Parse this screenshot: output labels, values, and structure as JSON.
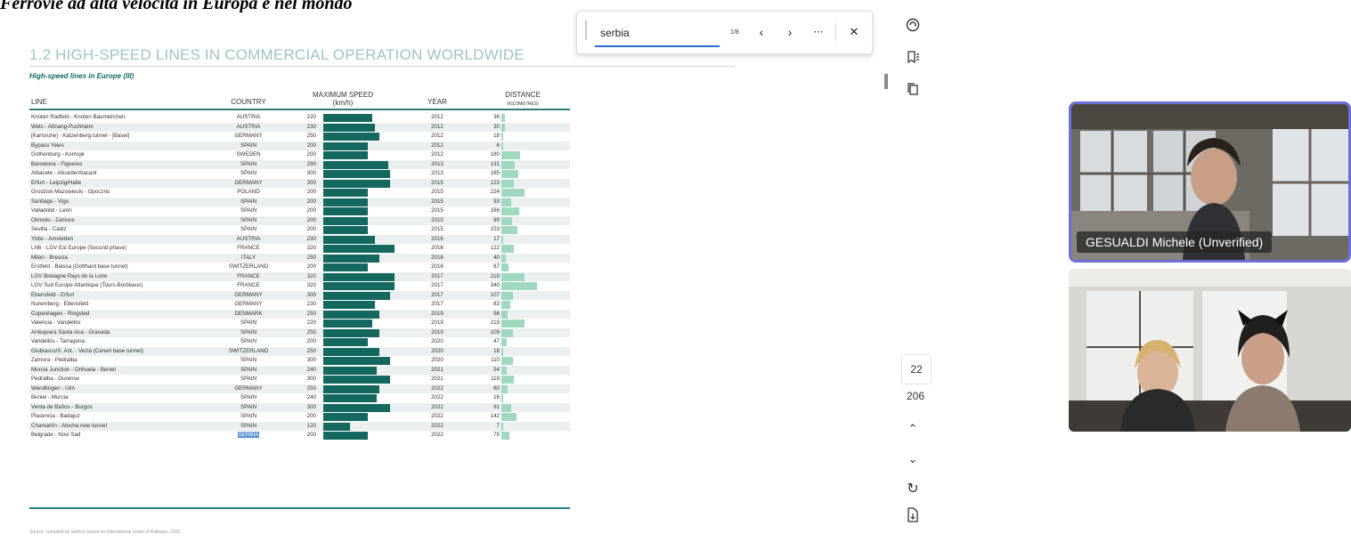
{
  "banner": {
    "text": "Ferrovie ad alta velocità in Europa e nel mondo"
  },
  "document": {
    "title": "1.2 HIGH-SPEED LINES IN COMMERCIAL OPERATION WORLDWIDE",
    "subtitle": "High-speed lines in Europe (III)",
    "columns": {
      "line": "LINE",
      "country": "COUNTRY",
      "speed": "MAXIMUM SPEED",
      "speed_unit": "(km/h)",
      "year": "YEAR",
      "distance": "DISTANCE",
      "distance_unit": "(KILOMETRES)"
    },
    "rows": [
      {
        "line": "Knoten Radfeld - Knoten Baumkirchen",
        "country": "AUSTRIA",
        "speed": 220,
        "year": "2012",
        "distance": 36
      },
      {
        "line": "Wels - Attnang-Puchheim",
        "country": "AUSTRIA",
        "speed": 230,
        "year": "2012",
        "distance": 30
      },
      {
        "line": "[Karlsruhe] - Katzenberg tunnel - [Basel]",
        "country": "GERMANY",
        "speed": 250,
        "year": "2012",
        "distance": 18
      },
      {
        "line": "Bypass Yeles",
        "country": "SPAIN",
        "speed": 200,
        "year": "2012",
        "distance": 6
      },
      {
        "line": "Gothenburg - Kornsjø",
        "country": "SWEDEN",
        "speed": 200,
        "year": "2012",
        "distance": 180
      },
      {
        "line": "Barcelona - Figueres",
        "country": "SPAIN",
        "speed": 290,
        "year": "2013",
        "distance": 131
      },
      {
        "line": "Albacete - Alicante/Alacant",
        "country": "SPAIN",
        "speed": 300,
        "year": "2013",
        "distance": 165
      },
      {
        "line": "Erfurt - Leipzig/Halle",
        "country": "GERMANY",
        "speed": 300,
        "year": "2015",
        "distance": 123
      },
      {
        "line": "Grodzisk Mazowiecki - Opoczno",
        "country": "POLAND",
        "speed": 200,
        "year": "2015",
        "distance": 224
      },
      {
        "line": "Santiago - Vigo",
        "country": "SPAIN",
        "speed": 200,
        "year": "2015",
        "distance": 93
      },
      {
        "line": "Valladolid - León",
        "country": "SPAIN",
        "speed": 200,
        "year": "2015",
        "distance": 166
      },
      {
        "line": "Olmedo - Zamora",
        "country": "SPAIN",
        "speed": 200,
        "year": "2015",
        "distance": 99
      },
      {
        "line": "Sevilla - Cádiz",
        "country": "SPAIN",
        "speed": 200,
        "year": "2015",
        "distance": 153
      },
      {
        "line": "Ybbs - Amstetten",
        "country": "AUSTRIA",
        "speed": 230,
        "year": "2016",
        "distance": 17
      },
      {
        "line": "LN6 - LGV Est Europe (Second phase)",
        "country": "FRANCE",
        "speed": 320,
        "year": "2016",
        "distance": 122
      },
      {
        "line": "Milan - Brescia",
        "country": "ITALY",
        "speed": 250,
        "year": "2016",
        "distance": 40
      },
      {
        "line": "Erstfeld - Biasca (Gotthard base tunnel)",
        "country": "SWITZERLAND",
        "speed": 200,
        "year": "2016",
        "distance": 67
      },
      {
        "line": "LGV Bretagne Pays de la Loire",
        "country": "FRANCE",
        "speed": 320,
        "year": "2017",
        "distance": 219
      },
      {
        "line": "LGV Sud Europe Atlantique (Tours-Bordeaux)",
        "country": "FRANCE",
        "speed": 320,
        "year": "2017",
        "distance": 340
      },
      {
        "line": "Ebensfeld - Erfurt",
        "country": "GERMANY",
        "speed": 300,
        "year": "2017",
        "distance": 107
      },
      {
        "line": "Nuremberg - Ebensfeld",
        "country": "GERMANY",
        "speed": 230,
        "year": "2017",
        "distance": 83
      },
      {
        "line": "Copenhagen - Ringsted",
        "country": "DENMARK",
        "speed": 250,
        "year": "2019",
        "distance": 56
      },
      {
        "line": "Valencia - Vandellòs",
        "country": "SPAIN",
        "speed": 220,
        "year": "2019",
        "distance": 219
      },
      {
        "line": "Antequera Santa Ana - Granada",
        "country": "SPAIN",
        "speed": 250,
        "year": "2019",
        "distance": 109
      },
      {
        "line": "Vandellòs - Tarragona",
        "country": "SPAIN",
        "speed": 200,
        "year": "2020",
        "distance": 47
      },
      {
        "line": "Giubiasco/S. Ant. - Vezia (Ceneri base tunnel)",
        "country": "SWITZERLAND",
        "speed": 250,
        "year": "2020",
        "distance": 18
      },
      {
        "line": "Zamora - Pedralba",
        "country": "SPAIN",
        "speed": 300,
        "year": "2020",
        "distance": 110
      },
      {
        "line": "Murcia Junction - Orihuela - Beniel",
        "country": "SPAIN",
        "speed": 240,
        "year": "2021",
        "distance": 54
      },
      {
        "line": "Pedralba - Ourense",
        "country": "SPAIN",
        "speed": 300,
        "year": "2021",
        "distance": 119
      },
      {
        "line": "Wendlingen - Ulm",
        "country": "GERMANY",
        "speed": 250,
        "year": "2022",
        "distance": 60
      },
      {
        "line": "Beniel - Murcia",
        "country": "SPAIN",
        "speed": 240,
        "year": "2022",
        "distance": 16
      },
      {
        "line": "Venta de Baños - Burgos",
        "country": "SPAIN",
        "speed": 300,
        "year": "2022",
        "distance": 91
      },
      {
        "line": "Plasencia - Badajoz",
        "country": "SPAIN",
        "speed": 200,
        "year": "2022",
        "distance": 142
      },
      {
        "line": "Chamartín - Atocha new tunnel",
        "country": "SPAIN",
        "speed": 120,
        "year": "2022",
        "distance": 7
      },
      {
        "line": "Belgrade - Novi Sad",
        "country": "SERBIA",
        "speed": 200,
        "year": "2022",
        "distance": 75,
        "highlight": true
      }
    ],
    "source": "Source: compiled by authors based on International Union of Railways, 2022"
  },
  "findbar": {
    "query": "serbia",
    "count": "1/8",
    "prev_icon": "chevron-left",
    "next_icon": "chevron-right",
    "more_icon": "more-horizontal",
    "close_icon": "close"
  },
  "toolbar": {
    "icons": [
      "ai-copilot",
      "bookmark-list",
      "copy-pages"
    ],
    "page_current": "22",
    "page_total": "206",
    "nav_icons": [
      "chevron-up",
      "chevron-down",
      "refresh",
      "save-document"
    ]
  },
  "video": {
    "participant1": {
      "name": "GESUALDI Michele (Unverified)"
    },
    "participant2": {
      "name": ""
    }
  },
  "colors": {
    "speed_bar": "#14685f",
    "distance_bar": "#9fd8bf",
    "title": "#9fc4c8",
    "active_speaker_border": "#6b6fd6",
    "highlight": "#5b8fd6"
  }
}
